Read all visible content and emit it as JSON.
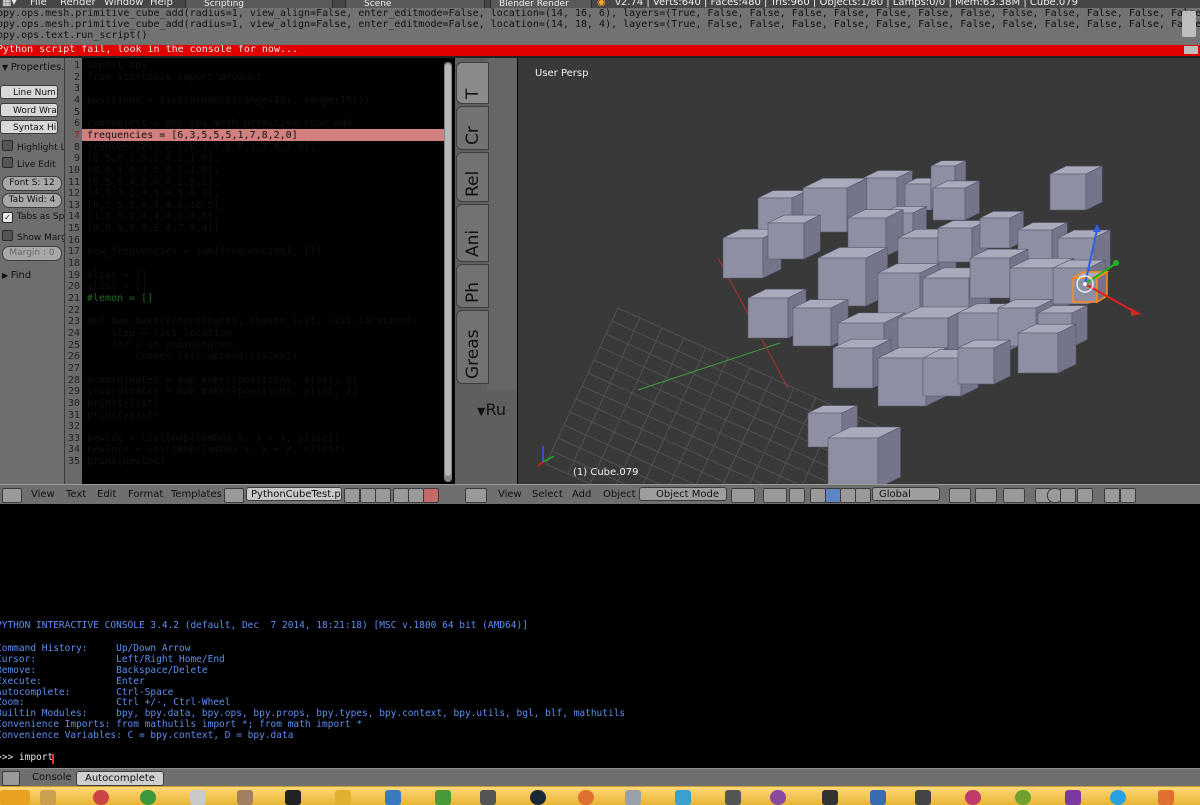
{
  "menu": {
    "items": [
      "File",
      "Render",
      "Window",
      "Help"
    ],
    "screen_layout": "Scripting",
    "scene": "Scene",
    "render_engine": "Blender Render",
    "stats": "v2.74 | Verts:640 | Faces:480 | Tris:960 | Objects:1/80 | Lamps:0/0 | Mem:63.38M | Cube.079"
  },
  "report_lines": [
    "bpy.ops.mesh.primitive_cube_add(radius=1, view_align=False, enter_editmode=False, location=(14, 16, 6), layers=(True, False, False, False, False, False, False, False, False, False, False, False, False, False,",
    "bpy.ops.mesh.primitive_cube_add(radius=1, view_align=False, enter_editmode=False, location=(14, 18, 4), layers=(True, False, False, False, False, False, False, False, False, False, False, False, False, False,",
    "bpy.ops.text.run_script()"
  ],
  "error_message": "Python script fail, look in the console for now...",
  "properties_panel": {
    "header": "Properties...",
    "line_numbers": "Line Num...",
    "word_wrap": "Word Wrap",
    "syntax_highlight": "Syntax Hi...",
    "highlight_line": "Highlight L",
    "live_edit": "Live Edit",
    "font_size": "Font S: 12",
    "tab_width": "Tab Wid: 4",
    "tabs_as_spaces": "Tabs as Sp",
    "show_margin": "Show Marg",
    "margin": "Margin : 0",
    "find": "Find"
  },
  "code": {
    "line_numbers": [
      "1",
      "2",
      "3",
      "4",
      "5",
      "6",
      "7",
      "8",
      "9",
      "10",
      "11",
      "12",
      "13",
      "14",
      "15",
      "16",
      "17",
      "18",
      "19",
      "20",
      "21",
      "22",
      "23",
      "24",
      "25",
      "26",
      "27",
      "28",
      "29",
      "30",
      "31",
      "32",
      "33",
      "34",
      "35"
    ],
    "lines": [
      "import bpy",
      "from itertools import product",
      "",
      "positions = list(product(range(10), range(10)))",
      "",
      "cubeobject = bpy.ops.mesh.primitive_cube_add",
      "frequencies = [6,3,5,5,5,1,7,8,2,0]",
      "frequencies1 = [[6,3,5,5,5,1,7,8,2,0],",
      "[6,5,6,2,9,3,4,3,1,0],",
      "[9,0,6,0,3,5,8,3,1,0],",
      "[5,5,5,4,2,4,4,3,5,2],",
      "[4,5,3,2,4,5,0,5,6,3],",
      "[6,7,5,5,6,4,8,6,10,5],",
      "[1,5,5,2,4,4,4,0,4,5],",
      "[0,0,5,9,9,8,4,7,6,4]]",
      "",
      "new_frequencies = sum(frequencies1, [])",
      "",
      "xlist = []",
      "ylist = []",
      "#lemon = []",
      "",
      "def map_maker(coordinates, chosen_list, list_location):",
      "    step = list_location",
      "    for i in coordinates:",
      "        chosen_list.append(i[step])",
      "",
      "xcoordinates = map_maker(positions, xlist, 0)",
      "ycoordinates = map_maker(positions, ylist, 1)",
      "print(xlist)",
      "print(ylist)",
      "",
      "newloc = list(map(lambda x: x + x, ylist))",
      "newlocx = list(map(lambda x: x + x, xlist))",
      "print(newloc)"
    ]
  },
  "tool_shelf": {
    "tabs": [
      "T",
      "Cr",
      "Rel",
      "Ani",
      "Ph",
      "Greas"
    ],
    "run_label": "Ru"
  },
  "viewport": {
    "view_name": "User Persp",
    "object_label": "(1) Cube.079"
  },
  "text_editor_header": {
    "menus": [
      "View",
      "Text",
      "Edit",
      "Format",
      "Templates"
    ],
    "filename": "PythonCubeTest.py"
  },
  "viewport_header": {
    "menus": [
      "View",
      "Select",
      "Add",
      "Object"
    ],
    "mode": "Object Mode",
    "orientation": "Global"
  },
  "console": {
    "lines": [
      "PYTHON INTERACTIVE CONSOLE 3.4.2 (default, Dec  7 2014, 18:21:18) [MSC v.1800 64 bit (AMD64)]",
      "",
      "Command History:     Up/Down Arrow",
      "Cursor:              Left/Right Home/End",
      "Remove:              Backspace/Delete",
      "Execute:             Enter",
      "Autocomplete:        Ctrl-Space",
      "Zoom:                Ctrl +/-, Ctrl-Wheel",
      "Builtin Modules:     bpy, bpy.data, bpy.ops, bpy.props, bpy.types, bpy.context, bpy.utils, bgl, blf, mathutils",
      "Convenience Imports: from mathutils import *; from math import *",
      "Convenience Variables: C = bpy.context, D = bpy.data"
    ],
    "prompt": ">>> import "
  },
  "console_header": {
    "tabs": [
      "Console",
      "Autocomplete"
    ]
  },
  "colors": {
    "error_bar": "#e00000",
    "highlight_line": "#d27f7f",
    "console_text": "#5c8ff0",
    "keyword": "#1a1aa8",
    "selection_orange": "#ff8c1a",
    "cube_gray": "#8e8fa3"
  }
}
